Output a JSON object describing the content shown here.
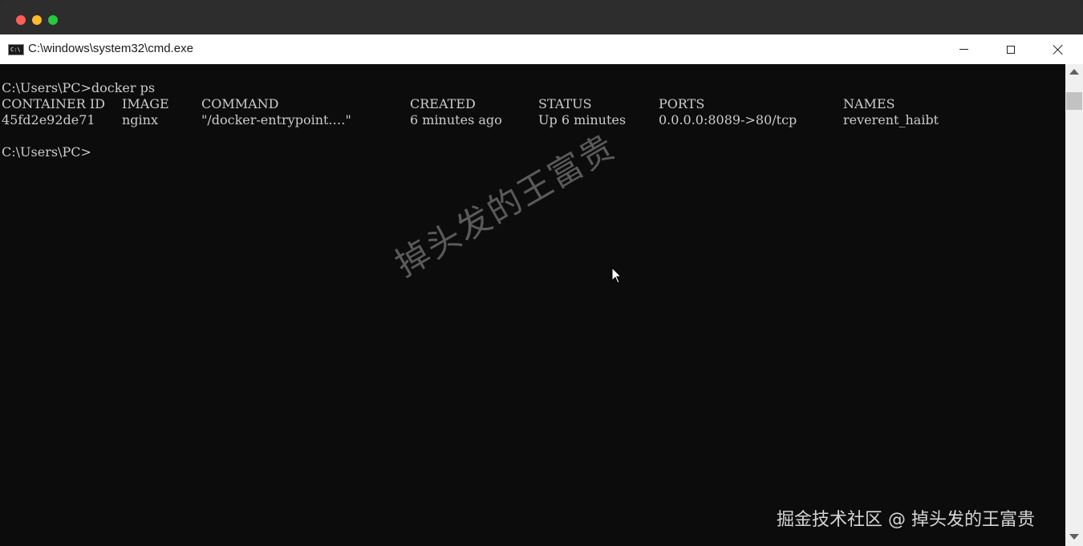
{
  "window": {
    "title": "C:\\windows\\system32\\cmd.exe",
    "controls": {
      "minimize_icon": "minimize-icon",
      "maximize_icon": "maximize-icon",
      "close_icon": "close-icon"
    }
  },
  "terminal": {
    "prompt_line": "C:\\Users\\PC>docker ps",
    "headers": [
      "CONTAINER ID",
      "IMAGE",
      "COMMAND",
      "CREATED",
      "STATUS",
      "PORTS",
      "NAMES"
    ],
    "rows": [
      [
        "45fd2e92de71",
        "nginx",
        "\"/docker-entrypoint.…\"",
        "6 minutes ago",
        "Up 6 minutes",
        "0.0.0.0:8089->80/tcp",
        "reverent_haibt"
      ]
    ],
    "final_prompt": "C:\\Users\\PC>"
  },
  "watermarks": {
    "diagonal": "掉头发的王富贵",
    "corner": "掘金技术社区 @ 掉头发的王富贵"
  },
  "colors": {
    "console_bg": "#0c0c0c",
    "console_text": "#cccccc",
    "titlebar_bg": "#ffffff"
  }
}
